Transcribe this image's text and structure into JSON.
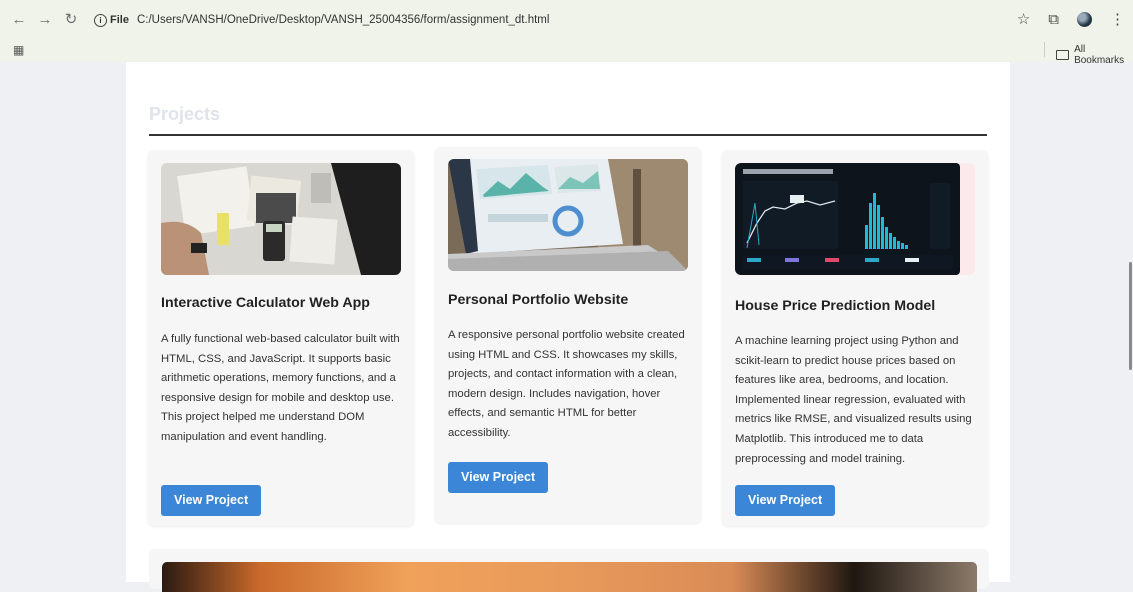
{
  "browser": {
    "file_label": "File",
    "url": "C:/Users/VANSH/OneDrive/Desktop/VANSH_25004356/form/assignment_dt.html",
    "bookmarks_label": "All Bookmarks"
  },
  "section": {
    "title": "Projects"
  },
  "projects": [
    {
      "title": "Interactive Calculator Web App",
      "description": "A fully functional web-based calculator built with HTML, CSS, and JavaScript. It supports basic arithmetic operations, memory functions, and a responsive design for mobile and desktop use. This project helped me understand DOM manipulation and event handling.",
      "button": "View Project"
    },
    {
      "title": "Personal Portfolio Website",
      "description": "A responsive personal portfolio website created using HTML and CSS. It showcases my skills, projects, and contact information with a clean, modern design. Includes navigation, hover effects, and semantic HTML for better accessibility.",
      "button": "View Project"
    },
    {
      "title": "House Price Prediction Model",
      "description": "A machine learning project using Python and scikit-learn to predict house prices based on features like area, bedrooms, and location. Implemented linear regression, evaluated with metrics like RMSE, and visualized results using Matplotlib. This introduced me to data preprocessing and model training.",
      "button": "View Project"
    }
  ],
  "colors": {
    "accent": "#3b86d6",
    "page_bg": "#eef0f3",
    "card_bg": "#f6f6f7"
  }
}
